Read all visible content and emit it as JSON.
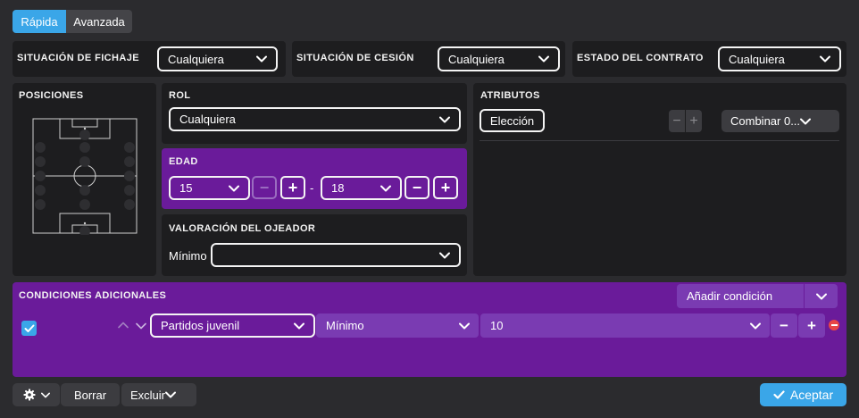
{
  "tabs": {
    "quick": "Rápida",
    "advanced": "Avanzada"
  },
  "filters": {
    "transfer_status": {
      "label": "SITUACIÓN DE FICHAJE",
      "value": "Cualquiera"
    },
    "loan_status": {
      "label": "SITUACIÓN DE CESIÓN",
      "value": "Cualquiera"
    },
    "contract_status": {
      "label": "ESTADO DEL CONTRATO",
      "value": "Cualquiera"
    }
  },
  "positions": {
    "label": "POSICIONES"
  },
  "role": {
    "label": "ROL",
    "value": "Cualquiera"
  },
  "age": {
    "label": "EDAD",
    "min": "15",
    "max": "18",
    "separator": "-",
    "minus": "−",
    "plus": "+"
  },
  "scout_rating": {
    "label": "VALORACIÓN DEL OJEADOR",
    "prefix": "Mínimo",
    "value": ""
  },
  "attributes": {
    "label": "ATRIBUTOS",
    "choice": "Elección",
    "combine": "Combinar 0...",
    "minus": "−",
    "plus": "+"
  },
  "conditions": {
    "label": "CONDICIONES ADICIONALES",
    "add": "Añadir condición",
    "row": {
      "field": "Partidos juvenil",
      "operator": "Mínimo",
      "value": "10",
      "minus": "−",
      "plus": "+"
    }
  },
  "footer": {
    "clear": "Borrar",
    "exclude": "Excluir",
    "accept": "Aceptar"
  },
  "colors": {
    "accent": "#3aa6e8",
    "purple": "#6a1b9a",
    "purple_light": "#7a3bb2",
    "panel": "#1d1d1f"
  },
  "icons": [
    "chevron-down-icon",
    "gear-icon",
    "check-icon",
    "checkbox-checked-icon",
    "remove-circle-icon",
    "chevron-up-icon",
    "pitch-diagram"
  ]
}
